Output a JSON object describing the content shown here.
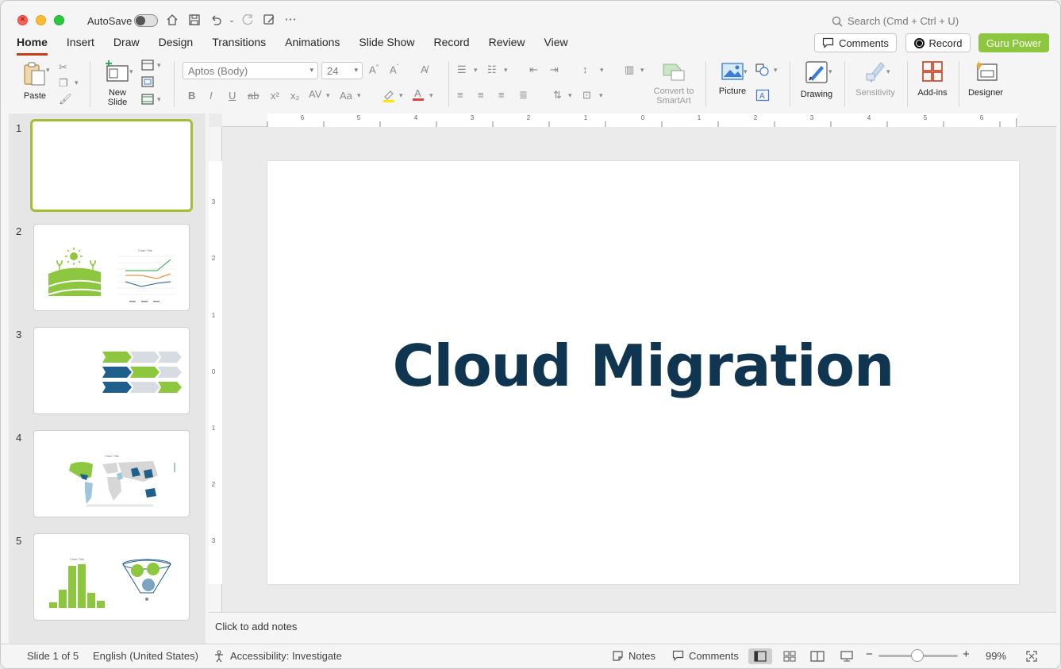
{
  "titlebar": {
    "autosave_label": "AutoSave",
    "search_placeholder": "Search (Cmd + Ctrl + U)"
  },
  "tabs": [
    {
      "label": "Home",
      "active": true
    },
    {
      "label": "Insert"
    },
    {
      "label": "Draw"
    },
    {
      "label": "Design"
    },
    {
      "label": "Transitions"
    },
    {
      "label": "Animations"
    },
    {
      "label": "Slide Show"
    },
    {
      "label": "Record"
    },
    {
      "label": "Review"
    },
    {
      "label": "View"
    }
  ],
  "header_buttons": {
    "comments": "Comments",
    "record": "Record",
    "guru": "Guru Power"
  },
  "ribbon": {
    "paste": "Paste",
    "new_slide_line1": "New",
    "new_slide_line2": "Slide",
    "font_name": "Aptos (Body)",
    "font_size": "24",
    "convert_line1": "Convert to",
    "convert_line2": "SmartArt",
    "picture": "Picture",
    "drawing": "Drawing",
    "sensitivity": "Sensitivity",
    "addins": "Add-ins",
    "designer": "Designer"
  },
  "ruler_labels": {
    "horizontal": [
      "6",
      "5",
      "4",
      "3",
      "2",
      "1",
      "0",
      "1",
      "2",
      "3",
      "4",
      "5",
      "6"
    ],
    "vertical": [
      "3",
      "2",
      "1",
      "0",
      "1",
      "2",
      "3"
    ]
  },
  "slides": [
    {
      "number": "1"
    },
    {
      "number": "2",
      "chart_title": "Chart Title"
    },
    {
      "number": "3"
    },
    {
      "number": "4",
      "chart_title": "Chart Title"
    },
    {
      "number": "5",
      "chart_title": "Chart Title"
    }
  ],
  "current_slide": {
    "title": "Cloud Migration"
  },
  "notes_placeholder": "Click to add notes",
  "status": {
    "slide_count": "Slide 1 of 5",
    "language": "English (United States)",
    "accessibility": "Accessibility: Investigate",
    "notes": "Notes",
    "comments": "Comments",
    "zoom": "99%"
  },
  "colors": {
    "accent_green": "#8dc63f",
    "title_navy": "#0f3550",
    "tab_underline": "#c43e1c"
  }
}
